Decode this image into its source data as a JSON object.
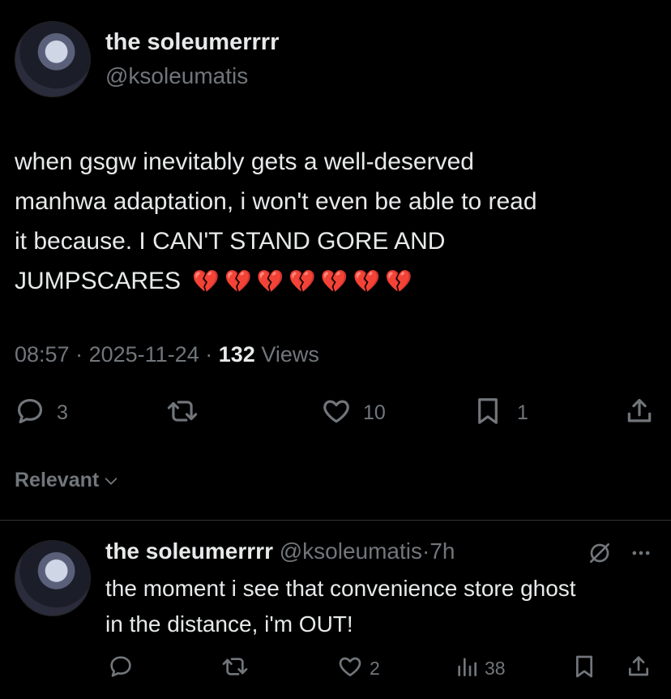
{
  "post": {
    "display_name": "the soleumerrrr",
    "handle": "@ksoleumatis",
    "text_lines": [
      "when gsgw inevitably gets a well-deserved",
      "manhwa adaptation, i won't even be able to read",
      "it because. I CAN'T STAND GORE AND",
      "JUMPSCARES"
    ],
    "emoji": "💔💔💔💔💔💔💔",
    "time": "08:57",
    "sep1": "·",
    "date": "2025-11-24",
    "sep2": "·",
    "views_count": "132",
    "views_label": "Views",
    "actions": {
      "reply_count": "3",
      "repost_count": "",
      "like_count": "10",
      "bookmark_count": "1"
    }
  },
  "sort": {
    "label": "Relevant"
  },
  "reply": {
    "display_name": "the soleumerrrr",
    "handle": "@ksoleumatis",
    "sep": "·",
    "age": "7h",
    "text_lines": [
      "the moment i see that convenience store ghost",
      "in the distance, i'm OUT!"
    ],
    "actions": {
      "reply_count": "",
      "repost_count": "",
      "like_count": "2",
      "views_count": "38"
    }
  },
  "icons": {
    "reply": "reply-icon",
    "repost": "repost-icon",
    "like": "heart-icon",
    "bookmark": "bookmark-icon",
    "share": "share-icon",
    "views": "views-icon",
    "grok": "grok-icon",
    "more": "more-icon",
    "chevron": "chevron-down-icon"
  },
  "colors": {
    "background": "#000000",
    "text": "#e7e9ea",
    "muted": "#71767b",
    "divider": "#2f3336"
  }
}
